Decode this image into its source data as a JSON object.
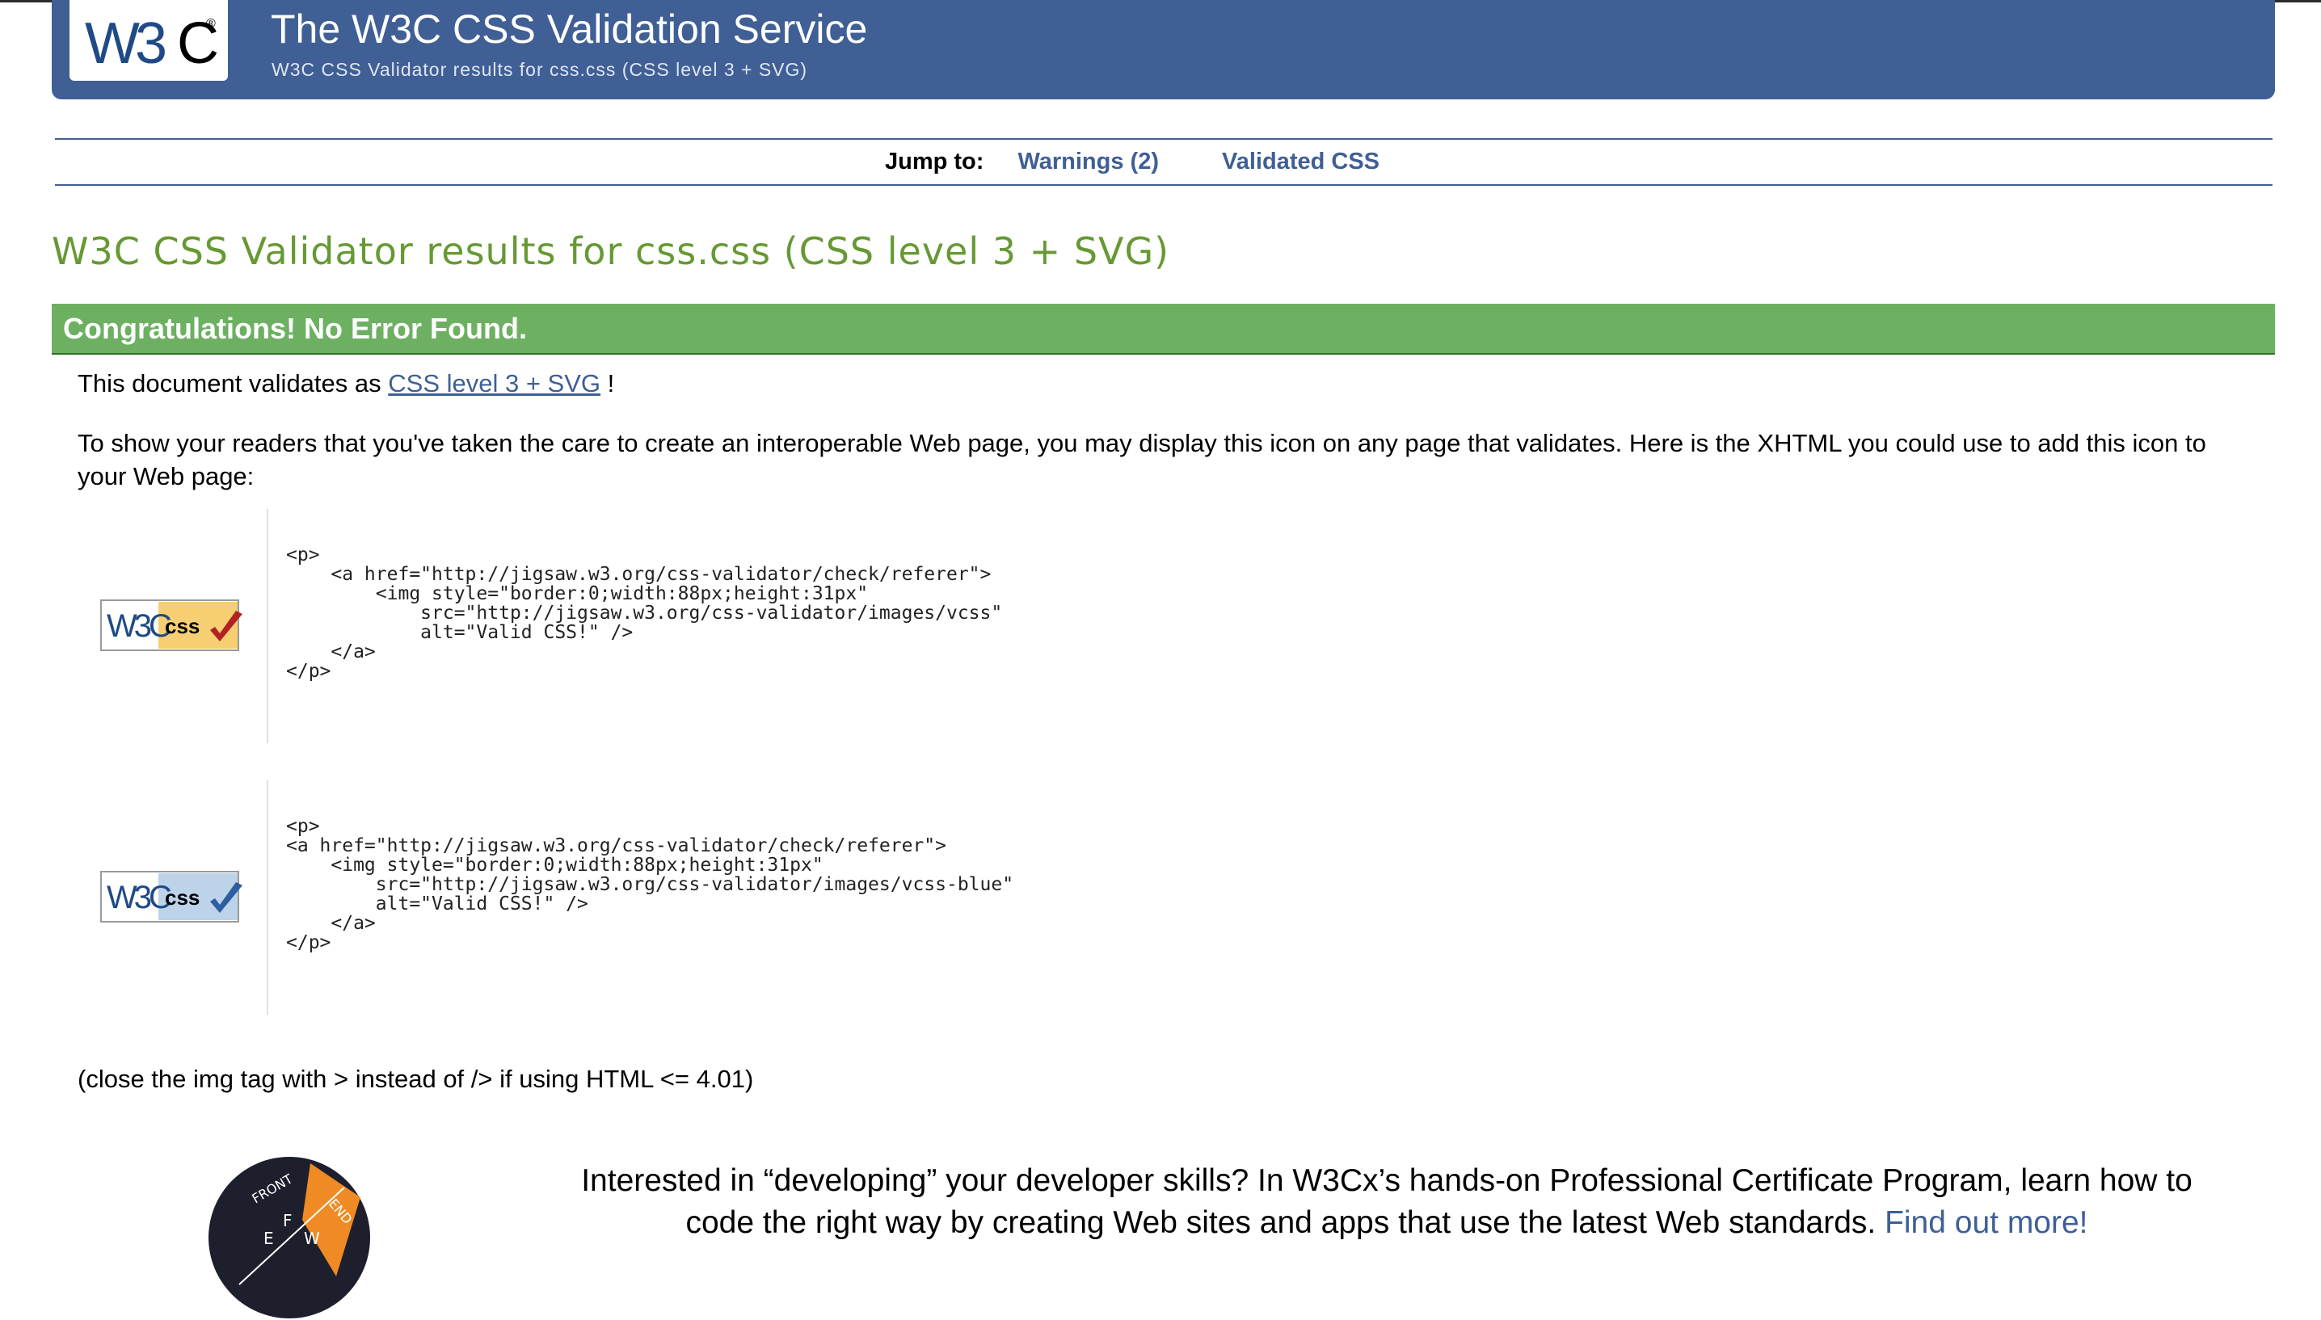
{
  "header": {
    "logo_text": "W3C®",
    "title": "The W3C CSS Validation Service",
    "subtitle": "W3C CSS Validator results for css.css (CSS level 3 + SVG)"
  },
  "jump_nav": {
    "label": "Jump to:",
    "links": [
      "Warnings (2)",
      "Validated CSS"
    ]
  },
  "results": {
    "title": "W3C CSS Validator results for css.css (CSS level 3 + SVG)",
    "banner": "Congratulations! No Error Found.",
    "validates_prefix": "This document validates as",
    "validates_link": "CSS level 3 + SVG",
    "validates_suffix": " !",
    "explain": "To show your readers that you've taken the care to create an interoperable Web page, you may display this icon on any page that validates. Here is the XHTML you could use to add this icon to your Web page:",
    "code_blocks": [
      {
        "badge": "W3C css",
        "code": "<p>\n    <a href=\"http://jigsaw.w3.org/css-validator/check/referer\">\n        <img style=\"border:0;width:88px;height:31px\"\n            src=\"http://jigsaw.w3.org/css-validator/images/vcss\"\n            alt=\"Valid CSS!\" />\n    </a>\n</p>"
      },
      {
        "badge": "W3C css",
        "code": "<p>\n<a href=\"http://jigsaw.w3.org/css-validator/check/referer\">\n    <img style=\"border:0;width:88px;height:31px\"\n        src=\"http://jigsaw.w3.org/css-validator/images/vcss-blue\"\n        alt=\"Valid CSS!\" />\n    </a>\n</p>"
      }
    ],
    "close_note": "(close the img tag with > instead of /> if using HTML <= 4.01)"
  },
  "promo": {
    "text": "Interested in “developing” your developer skills? In W3Cx’s hands-on Professional Certificate Program, learn how to code the right way by creating Web sites and apps that use the latest Web standards.",
    "link": "Find out more!",
    "logo_letters": "FRONT END F E W"
  },
  "colors": {
    "banner": "#3f5f95",
    "link": "#3f5f95",
    "results_title": "#669933",
    "success": "#6db062"
  }
}
